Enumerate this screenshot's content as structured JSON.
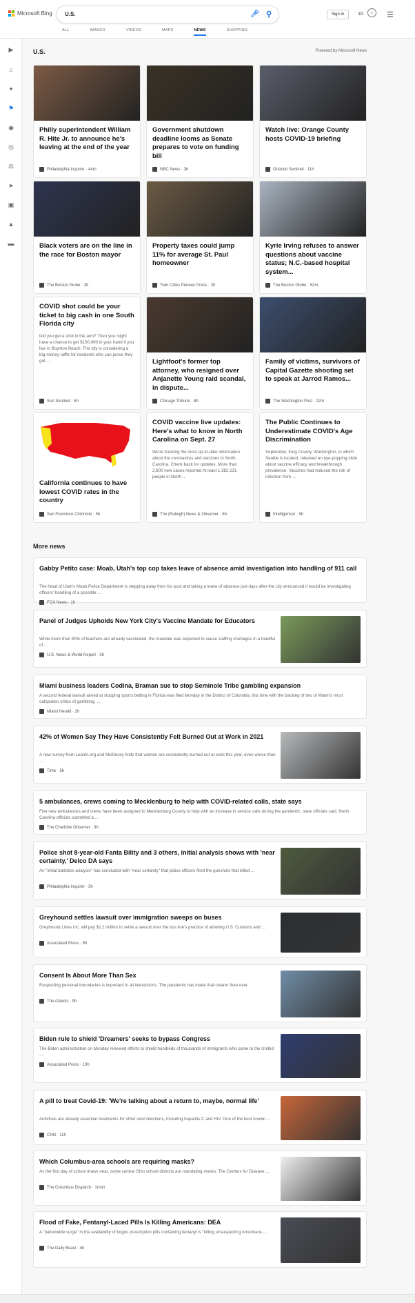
{
  "brand": {
    "name": "Microsoft Bing"
  },
  "search": {
    "query": "U.S."
  },
  "header": {
    "sign_in": "Sign in",
    "reward_count": "10"
  },
  "tabs": [
    "ALL",
    "IMAGES",
    "VIDEOS",
    "MAPS",
    "NEWS",
    "SHOPPING"
  ],
  "active_tab": "NEWS",
  "section": {
    "title": "U.S.",
    "powered_by": "Powered by Microsoft News"
  },
  "top_cards": [
    {
      "title": "Philly superintendent William R. Hite Jr. to announce he's leaving at the end of the year",
      "snippet": "",
      "source": "Philadelphia Inquirer",
      "time": "44m",
      "img": "#7d5a44"
    },
    {
      "title": "Government shutdown deadline looms as Senate prepares to vote on funding bill",
      "snippet": "",
      "source": "NBC News",
      "time": "3h",
      "img": "#3a3226"
    },
    {
      "title": "Watch live: Orange County hosts COVID-19 briefing",
      "snippet": "",
      "source": "Orlando Sentinel",
      "time": "11h",
      "img": "#5a5e6a"
    },
    {
      "title": "Black voters are on the line in the race for Boston mayor",
      "snippet": "",
      "source": "The Boston Globe",
      "time": "2h",
      "img": "#2e3450"
    },
    {
      "title": "Property taxes could jump 11% for average St. Paul homeowner",
      "snippet": "",
      "source": "Twin Cities Pioneer Press",
      "time": "2h",
      "img": "#6b5b44"
    },
    {
      "title": "Kyrie Irving refuses to answer questions about vaccine status; N.C.-based hospital system...",
      "snippet": "",
      "source": "The Boston Globe",
      "time": "52m",
      "img": "#a9b3bf"
    },
    {
      "title": "COVID shot could be your ticket to big cash in one South Florida city",
      "snippet": "Did you get a shot in the arm? Then you might have a chance to get $100,000 in your hand if you live in Boynton Beach. The city is considering a big-money raffle for residents who can prove they got ...",
      "source": "Sun Sentinel",
      "time": "5h",
      "img": ""
    },
    {
      "title": "Lightfoot's former top attorney, who resigned over Anjanette Young raid scandal, in dispute...",
      "snippet": "",
      "source": "Chicago Tribune",
      "time": "8h",
      "img": "#4a3a30"
    },
    {
      "title": "Family of victims, survivors of Capital Gazette shooting set to speak at Jarrod Ramos...",
      "snippet": "",
      "source": "The Washington Post",
      "time": "22m",
      "img": "#3c4e6e"
    },
    {
      "title": "California continues to have lowest COVID rates in the country",
      "snippet": "",
      "source": "San Francisco Chronicle",
      "time": "5h",
      "img": "map"
    },
    {
      "title": "COVID vaccine live updates: Here's what to know in North Carolina on Sept. 27",
      "snippet": "We're tracking the most up-to-date information about the coronavirus and vaccines in North Carolina. Check back for updates. More than 2,600 new cases reported At least 1,382,231 people in North ...",
      "source": "The (Raleigh) News & Observer",
      "time": "6h",
      "img": ""
    },
    {
      "title": "The Public Continues to Underestimate COVID's Age Discrimination",
      "snippet": "September, King County, Washington, in which Seattle is located, released an eye-popping slide about vaccine efficacy and breakthrough prevalence: Vaccines had reduced the risk of infection from ...",
      "source": "Intelligencer",
      "time": "9h",
      "img": ""
    }
  ],
  "more_news_title": "More news",
  "more_news": [
    {
      "title": "Gabby Petito case: Moab, Utah's top cop takes leave of absence amid investigation into handling of 911 call",
      "snippet": "The head of Utah's Moab Police Department is stepping away from his post and taking a leave of absence just days after the city announced it would be investigating officers' handling of a possible ...",
      "source": "FOX News",
      "time": "1h",
      "thumb": ""
    },
    {
      "title": "Panel of Judges Upholds New York City's Vaccine Mandate for Educators",
      "snippet": "While more than 90% of teachers are already vaccinated, the mandate was expected to cause staffing shortages in a handful of ...",
      "source": "U.S. News & World Report",
      "time": "3h",
      "thumb": "#7a9a5a"
    },
    {
      "title": "Miami business leaders Codina, Braman sue to stop Seminole Tribe gambling expansion",
      "snippet": "A second federal lawsuit aimed at stopping sports betting in Florida was filed Monday in the District of Columbia, this time with the backing of two of Miami's most outspoken critics of gambling, ...",
      "source": "Miami Herald",
      "time": "2h",
      "thumb": ""
    },
    {
      "title": "42% of Women Say They Have Consistently Felt Burned Out at Work in 2021",
      "snippet": "A new survey from LeanIn.org and McKinsey finds that women are consistently burned out at work this year, even worse than ...",
      "source": "Time",
      "time": "5h",
      "thumb": "#b7b9bb"
    },
    {
      "title": "5 ambulances, crews coming to Mecklenburg to help with COVID-related calls, state says",
      "snippet": "Five new ambulances and crews have been assigned to Mecklenburg County to help with an increase in service calls during the pandemic, state officials said. North Carolina officials submitted a ...",
      "source": "The Charlotte Observer",
      "time": "3h",
      "thumb": ""
    },
    {
      "title": "Police shot 8-year-old Fanta Bility and 3 others, initial analysis shows with 'near certainty,' Delco DA says",
      "snippet": "An \"initial ballistics analysis\" has concluded with \"near certainty\" that police officers fired the gunshots that killed ...",
      "source": "Philadelphia Inquirer",
      "time": "3h",
      "thumb": "#4f5a3e"
    },
    {
      "title": "Greyhound settles lawsuit over immigration sweeps on buses",
      "snippet": "Greyhound Lines Inc. will pay $2.2 million to settle a lawsuit over the bus line's practice of allowing U.S. Customs and ...",
      "source": "Associated Press",
      "time": "9h",
      "thumb": "#2b2e33"
    },
    {
      "title": "Consent Is About More Than Sex",
      "snippet": "Respecting personal boundaries is important in all interactions. The pandemic has made that clearer than ever.",
      "source": "The Atlantic",
      "time": "9h",
      "thumb": "#6f8da6"
    },
    {
      "title": "Biden rule to shield 'Dreamers' seeks to bypass Congress",
      "snippet": "The Biden administration on Monday renewed efforts to shield hundreds of thousands of immigrants who came to the United ...",
      "source": "Associated Press",
      "time": "10h",
      "thumb": "#2f3d70"
    },
    {
      "title": "A pill to treat Covid-19: 'We're talking about a return to, maybe, normal life'",
      "snippet": "Antivirals are already essential treatments for other viral infections, including hepatitis C and HIV. One of the best known ...",
      "source": "CNN",
      "time": "11h",
      "thumb": "#c7663a"
    },
    {
      "title": "Which Columbus-area schools are requiring masks?",
      "snippet": "As the first day of school draws near, some central Ohio school districts are mandating masks. The Centers for Disease ...",
      "source": "The Columbus Dispatch",
      "time": "1mon",
      "thumb": "#efefef"
    },
    {
      "title": "Flood of Fake, Fentanyl-Laced Pills Is Killing Americans: DEA",
      "snippet": "A \"nationwide surge\" in the availability of bogus prescription pills containing fentanyl is \"killing unsuspecting Americans ...",
      "source": "The Daily Beast",
      "time": "4h",
      "thumb": "#4a4d55"
    }
  ],
  "icons": [
    "chevron-right-icon",
    "home-icon",
    "sparkle-icon",
    "flag-icon",
    "location-icon",
    "globe-icon",
    "microscope-icon",
    "rocket-icon",
    "film-icon",
    "bank-icon",
    "credit-card-icon"
  ]
}
